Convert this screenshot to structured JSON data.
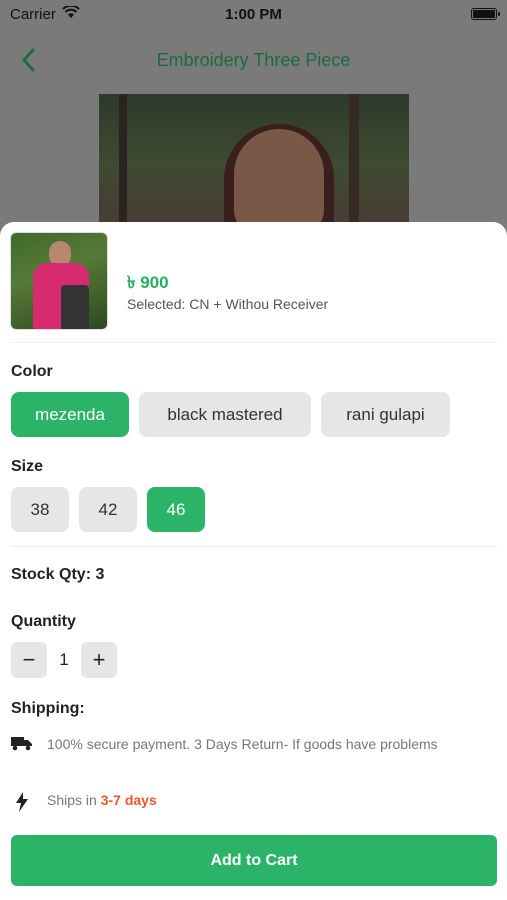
{
  "status_bar": {
    "carrier": "Carrier",
    "time": "1:00 PM"
  },
  "header": {
    "title": "Embroidery Three Piece",
    "back_icon": "chevron-left-icon"
  },
  "product": {
    "price": "৳ 900",
    "selected": "Selected: CN + Withou Receiver"
  },
  "color": {
    "label": "Color",
    "options": [
      "mezenda",
      "black mastered",
      "rani gulapi"
    ],
    "selected": "mezenda"
  },
  "size": {
    "label": "Size",
    "options": [
      "38",
      "42",
      "46"
    ],
    "selected": "46"
  },
  "stock": {
    "label": "Stock Qty: 3"
  },
  "quantity": {
    "label": "Quantity",
    "minus": "−",
    "value": "1",
    "plus": "+"
  },
  "shipping": {
    "label": "Shipping:",
    "payment_text": "100% secure payment. 3 Days Return- If goods have problems",
    "ships_prefix": "Ships in ",
    "ships_days": "3-7 days"
  },
  "cart": {
    "label": "Add to Cart"
  },
  "colors": {
    "accent": "#2bb468",
    "highlight": "#f2552c",
    "chip_bg": "#e6e6e6"
  }
}
